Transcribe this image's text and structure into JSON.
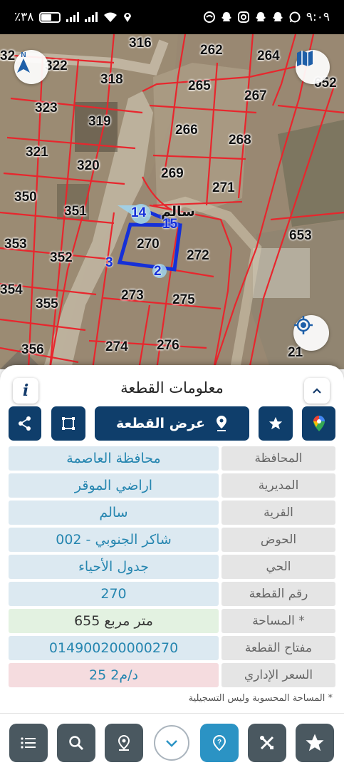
{
  "status_bar": {
    "time": "٩:٠٩",
    "battery": "٪٣٨",
    "icons": [
      "notification-icon",
      "snapchat-icon",
      "instagram-icon",
      "snapchat-icon",
      "snapchat-icon",
      "whatsapp-icon",
      "wifi-icon",
      "location-icon",
      "signal-icon"
    ]
  },
  "map": {
    "village_label": "سالم",
    "selected_parcel": "270",
    "parcel_numbers": [
      "316",
      "262",
      "264",
      "322",
      "318",
      "265",
      "267",
      "652",
      "323",
      "319",
      "266",
      "268",
      "321",
      "320",
      "269",
      "271",
      "350",
      "351",
      "653",
      "353",
      "352",
      "272",
      "354",
      "355",
      "273",
      "275",
      "356",
      "274",
      "276",
      "21",
      "32"
    ],
    "edge_labels": [
      "14",
      "15",
      "3",
      "2"
    ],
    "compass_icon": "north-arrow-icon",
    "layers_icon": "map-layers-icon",
    "locate_icon": "my-location-icon"
  },
  "panel": {
    "title": "معلومات القطعة",
    "info_label": "i",
    "show_parcel_label": "عرض القطعة",
    "rows": [
      {
        "label": "المحافظة",
        "value": "محافظة العاصمة",
        "style": "blue"
      },
      {
        "label": "المديرية",
        "value": "اراضي الموقر",
        "style": "blue"
      },
      {
        "label": "القرية",
        "value": "سالم",
        "style": "blue"
      },
      {
        "label": "الحوض",
        "value": "شاكر الجنوبي - 002",
        "style": "blue"
      },
      {
        "label": "الحي",
        "value": "جدول الأحياء",
        "style": "blue"
      },
      {
        "label": "رقم القطعة",
        "value": "270",
        "style": "blue"
      },
      {
        "label": "المساحة *",
        "value": "655  متر مربع",
        "style": "green"
      },
      {
        "label": "مفتاح القطعة",
        "value": "014900200000270",
        "style": "blue"
      },
      {
        "label": "السعر الإداري",
        "value": "25 د/م2",
        "style": "red"
      }
    ],
    "footnote": "* المساحة المحسوبة وليس التسجيلية"
  },
  "bottom_nav": {
    "items": [
      "list-icon",
      "search-icon",
      "location-pin-icon",
      "chevron-down-icon",
      "help-pin-icon",
      "tools-icon",
      "star-icon"
    ],
    "active": "help-pin-icon"
  },
  "colors": {
    "primary": "#0f3e6b",
    "value_text": "#2686b0",
    "parcel_line": "#e8262d",
    "selected_outline": "#1530d8",
    "active_nav": "#2b93c4"
  }
}
